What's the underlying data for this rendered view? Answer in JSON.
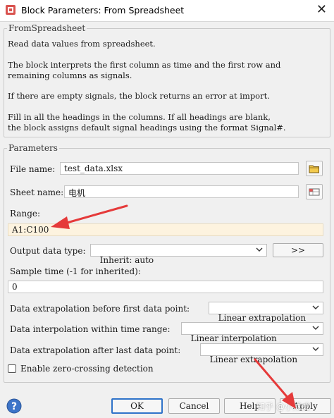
{
  "window": {
    "title": "Block Parameters: From Spreadsheet",
    "close_glyph": "✕"
  },
  "description": {
    "group_title": "FromSpreadsheet",
    "lines": [
      "Read data values from spreadsheet.",
      "The block interprets the first column as time and the first row and",
      "remaining columns as signals.",
      "If there are empty signals, the block returns an error at import.",
      "Fill in all the headings in the columns. If all headings are blank,",
      "the block assigns default signal headings using the format Signal#."
    ]
  },
  "parameters": {
    "group_title": "Parameters",
    "file_name": {
      "label": "File name:",
      "value": "test_data.xlsx",
      "button_icon": "folder-icon"
    },
    "sheet_name": {
      "label": "Sheet name:",
      "value": "电机",
      "button_icon": "spreadsheet-icon"
    },
    "range": {
      "label": "Range:",
      "value": "A1:C100",
      "highlight_color": "#fdf3df"
    },
    "output_data_type": {
      "label": "Output data type:",
      "selected": "Inherit: auto",
      "assistant_button_label": ">>"
    },
    "sample_time": {
      "label": "Sample time (-1 for inherited):",
      "value": "0"
    },
    "extrap_before": {
      "label": "Data extrapolation before first data point:",
      "selected": "Linear extrapolation"
    },
    "interp_within": {
      "label": "Data interpolation within time range:",
      "selected": "Linear interpolation"
    },
    "extrap_after": {
      "label": "Data extrapolation after last data point:",
      "selected": "Linear extrapolation"
    },
    "zero_crossing": {
      "label": "Enable zero-crossing detection",
      "checked": false
    }
  },
  "buttons": {
    "help_icon": "help-icon",
    "ok": "OK",
    "cancel": "Cancel",
    "help": "Help",
    "apply": "Apply"
  },
  "annotations": {
    "arrow_color": "#e53a3a",
    "watermark": "知乎 @小成成"
  }
}
